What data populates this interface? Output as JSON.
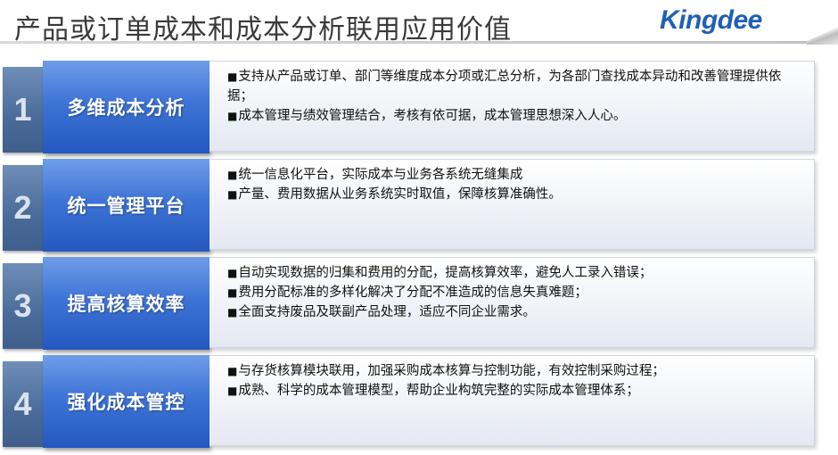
{
  "header": {
    "title": "产品或订单成本和成本分析联用应用价值",
    "logo_text": "Kingdee"
  },
  "colors": {
    "accent_blue": "#2458bf",
    "number_block": "#4a6b99",
    "logo_blue": "#1f5fb8"
  },
  "rows": [
    {
      "number": "1",
      "label": "多维成本分析",
      "bullets": [
        "支持从产品或订单、部门等维度成本分项或汇总分析，为各部门查找成本异动和改善管理提供依据；",
        "成本管理与绩效管理结合，考核有依可据，成本管理思想深入人心。"
      ]
    },
    {
      "number": "2",
      "label": "统一管理平台",
      "bullets": [
        "统一信息化平台，实际成本与业务各系统无缝集成",
        "产量、费用数据从业务系统实时取值，保障核算准确性。"
      ]
    },
    {
      "number": "3",
      "label": "提高核算效率",
      "bullets": [
        "自动实现数据的归集和费用的分配，提高核算效率，避免人工录入错误；",
        "费用分配标准的多样化解决了分配不准造成的信息失真难题；",
        "全面支持废品及联副产品处理，适应不同企业需求。"
      ]
    },
    {
      "number": "4",
      "label": "强化成本管控",
      "bullets": [
        "与存货核算模块联用，加强采购成本核算与控制功能，有效控制采购过程；",
        "成熟、科学的成本管理模型，帮助企业构筑完整的实际成本管理体系；"
      ]
    }
  ]
}
